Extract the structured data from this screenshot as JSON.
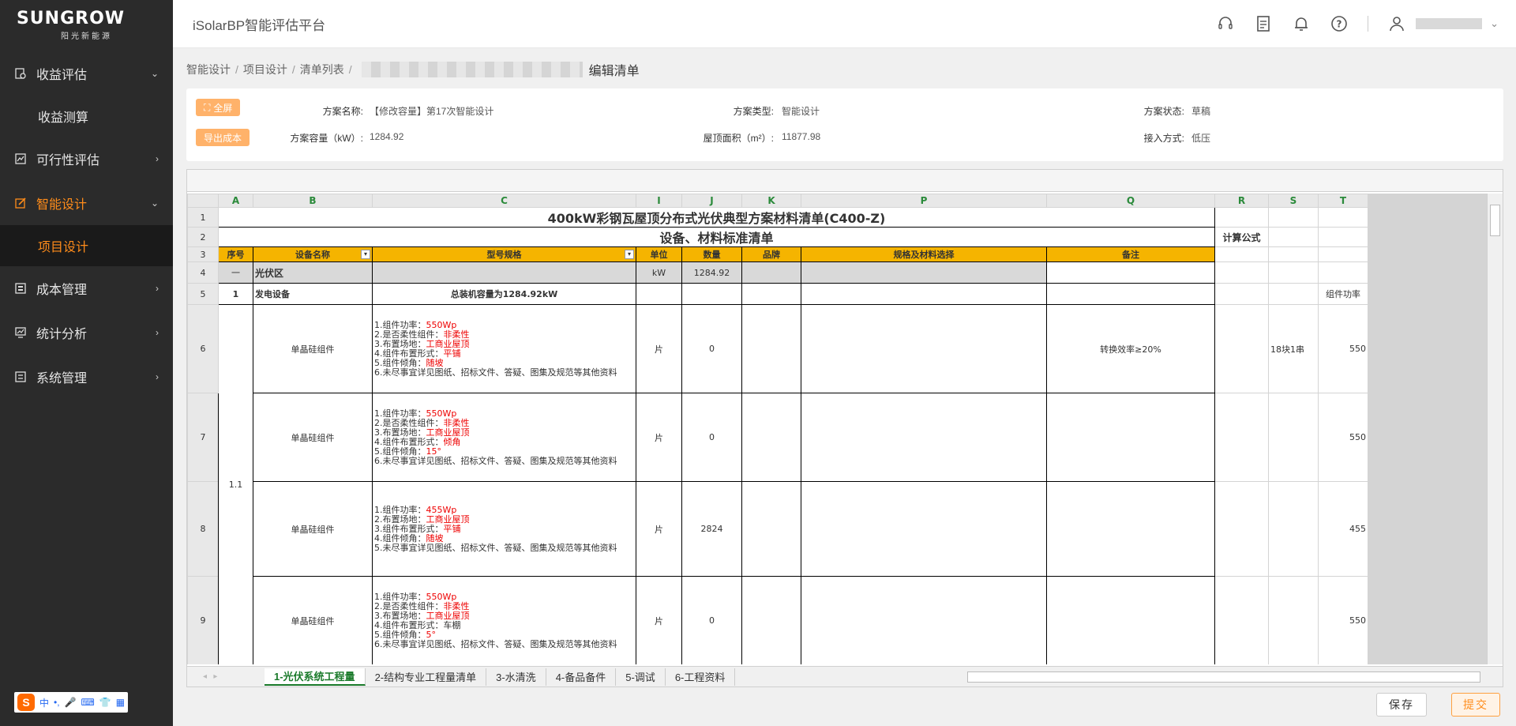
{
  "sidebar": {
    "brand": "SUNGROW",
    "brand_sub": "阳光新能源",
    "items": [
      {
        "label": "收益评估",
        "arrow": "⌄"
      },
      {
        "label": "收益测算"
      },
      {
        "label": "可行性评估",
        "arrow": "›"
      },
      {
        "label": "智能设计",
        "arrow": "⌄"
      },
      {
        "label": "项目设计"
      },
      {
        "label": "成本管理",
        "arrow": "›"
      },
      {
        "label": "统计分析",
        "arrow": "›"
      },
      {
        "label": "系统管理",
        "arrow": "›"
      }
    ],
    "ime": [
      "中",
      "•,"
    ]
  },
  "header": {
    "title": "iSolarBP智能评估平台",
    "user_arrow": "⌄"
  },
  "breadcrumb": {
    "items": [
      "智能设计",
      "项目设计",
      "清单列表",
      "编辑清单"
    ],
    "sep": "/"
  },
  "info": {
    "fullscreen_label": "全屏",
    "export_label": "导出成本",
    "name_label": "方案名称:",
    "name_value": "【修改容量】第17次智能设计",
    "type_label": "方案类型:",
    "type_value": "智能设计",
    "status_label": "方案状态:",
    "status_value": "草稿",
    "capacity_label": "方案容量（kW）:",
    "capacity_value": "1284.92",
    "roof_label": "屋顶面积（m²）:",
    "roof_value": "11877.98",
    "access_label": "接入方式:",
    "access_value": "低压"
  },
  "sheet": {
    "cols": [
      "A",
      "B",
      "C",
      "I",
      "J",
      "K",
      "P",
      "Q",
      "R",
      "S",
      "T"
    ],
    "rows": [
      "1",
      "2",
      "3",
      "4",
      "5",
      "6",
      "7",
      "8",
      "9"
    ],
    "title1": "400kW彩钢瓦屋顶分布式光伏典型方案材料清单(C400-Z)",
    "title2": "设备、材料标准清单",
    "calc_formula": "计算公式",
    "headers": [
      "序号",
      "设备名称",
      "型号规格",
      "单位",
      "数量",
      "品牌",
      "规格及材料选择",
      "备注"
    ],
    "filter_icon": "▾",
    "r4": {
      "a": "一",
      "b": "光伏区",
      "unit": "kW",
      "qty": "1284.92"
    },
    "r5": {
      "a": "1",
      "b": "发电设备",
      "c": "总装机容量为1284.92kW",
      "t": "组件功率"
    },
    "group_no": "1.1",
    "r6": {
      "b": "单晶硅组件",
      "unit": "片",
      "qty": "0",
      "note": "转换效率≥20%",
      "s": "18块1串",
      "t": "550",
      "spec": [
        [
          "1.组件功率：",
          "550Wp"
        ],
        [
          "2.是否柔性组件：",
          "非柔性"
        ],
        [
          "3.布置场地：",
          "工商业屋顶"
        ],
        [
          "4.组件布置形式：",
          "平铺"
        ],
        [
          "5.组件倾角：",
          "随坡"
        ],
        [
          "6.未尽事宜详见图纸、招标文件、答疑、图集及规范等其他资料",
          ""
        ]
      ]
    },
    "r7": {
      "b": "单晶硅组件",
      "unit": "片",
      "qty": "0",
      "t": "550",
      "spec": [
        [
          "1.组件功率：",
          "550Wp"
        ],
        [
          "2.是否柔性组件：",
          "非柔性"
        ],
        [
          "3.布置场地：",
          "工商业屋顶"
        ],
        [
          "4.组件布置形式：",
          "倾角"
        ],
        [
          "5.组件倾角：",
          "15°"
        ],
        [
          "6.未尽事宜详见图纸、招标文件、答疑、图集及规范等其他资料",
          ""
        ]
      ]
    },
    "r8": {
      "b": "单晶硅组件",
      "unit": "片",
      "qty": "2824",
      "t": "455",
      "spec": [
        [
          "1.组件功率：",
          "455Wp"
        ],
        [
          "2.布置场地：",
          "工商业屋顶"
        ],
        [
          "3.组件布置形式：",
          "平铺"
        ],
        [
          "4.组件倾角：",
          "随坡"
        ],
        [
          "5.未尽事宜详见图纸、招标文件、答疑、图集及规范等其他资料",
          ""
        ]
      ]
    },
    "r9": {
      "b": "单晶硅组件",
      "unit": "片",
      "qty": "0",
      "t": "550",
      "spec": [
        [
          "1.组件功率：",
          "550Wp"
        ],
        [
          "2.是否柔性组件：",
          "非柔性"
        ],
        [
          "3.布置场地：",
          "工商业屋顶"
        ],
        [
          "4.组件布置形式：",
          "车棚"
        ],
        [
          "5.组件倾角：",
          "5°"
        ],
        [
          "6.未尽事宜详见图纸、招标文件、答疑、图集及规范等其他资料",
          ""
        ]
      ]
    },
    "tabs": [
      "1-光伏系统工程量",
      "2-结构专业工程量清单",
      "3-水清洗",
      "4-备品备件",
      "5-调试",
      "6-工程资料"
    ]
  },
  "footer": {
    "save": "保存",
    "submit": "提交"
  },
  "colors": {
    "accent": "#ff8c1a",
    "sidebar": "#2b2b2b",
    "header_yellow": "#f5b400"
  }
}
